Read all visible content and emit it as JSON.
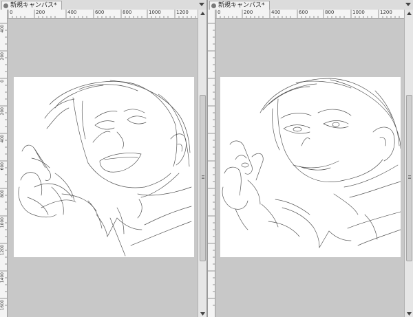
{
  "tabs": [
    {
      "title": "新規キャンバス*"
    },
    {
      "title": "新規キャンバス*"
    }
  ],
  "ruler": {
    "left_h_ticks": [
      "0",
      "200",
      "400",
      "600",
      "800",
      "1000",
      "1200"
    ],
    "right_h_ticks": [
      "0",
      "200",
      "400",
      "600",
      "800",
      "1000",
      "1200"
    ],
    "v_ticks": [
      "400",
      "200",
      "0",
      "200",
      "400",
      "600",
      "800",
      "1000",
      "1200",
      "1400",
      "1600"
    ]
  },
  "icons": {
    "tab_close": "dot-icon",
    "tab_menu": "chevron-down-icon",
    "scroll_up": "arrow-up-icon",
    "scroll_down": "arrow-down-icon"
  },
  "colors": {
    "workspace": "#c8c8c8",
    "canvas": "#ffffff",
    "ruler": "#f4f4f4",
    "sketch": "#555555"
  }
}
